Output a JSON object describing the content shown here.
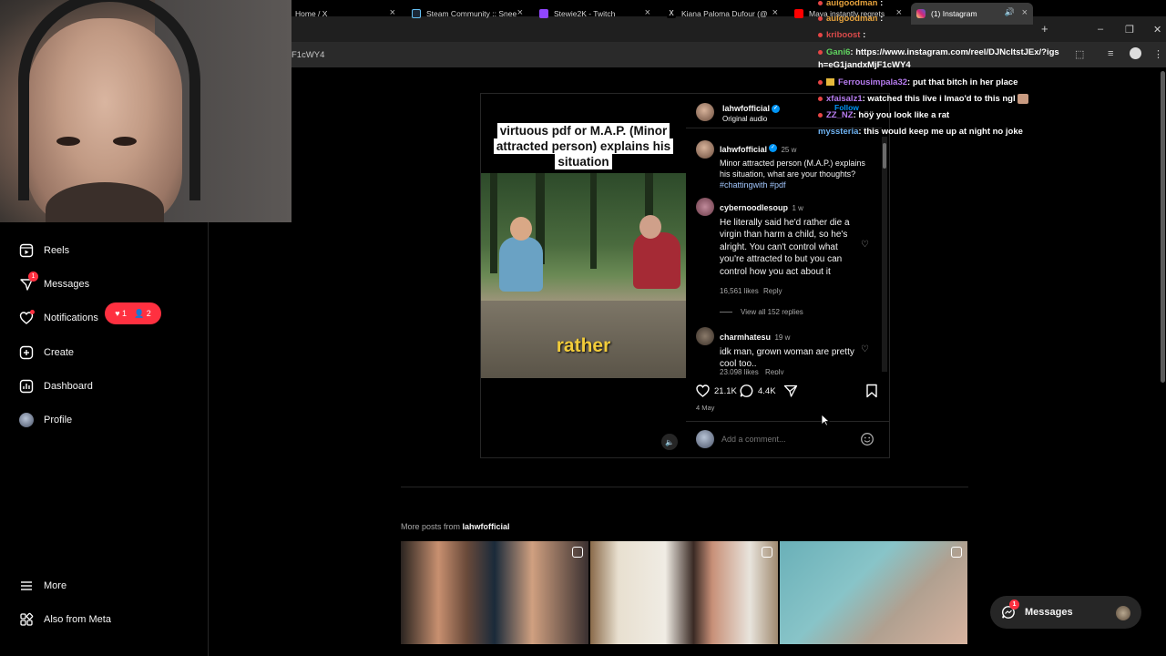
{
  "browser": {
    "tabs": [
      {
        "label": "Home / X",
        "active": false
      },
      {
        "label": "Steam Community :: Snee",
        "active": false
      },
      {
        "label": "Stewie2K - Twitch",
        "active": false
      },
      {
        "label": "Kiana Paloma Dufour (@",
        "active": false
      },
      {
        "label": "Maya instantly regrets",
        "active": false
      },
      {
        "label": "(1) Instagram",
        "active": true
      }
    ],
    "new_tab": "+",
    "url_fragment": "F1cWY4"
  },
  "sidebar": {
    "items": [
      {
        "label": "Reels",
        "icon": "reels-icon"
      },
      {
        "label": "Messages",
        "icon": "messenger-icon",
        "badge": "1"
      },
      {
        "label": "Notifications",
        "icon": "heart-icon"
      },
      {
        "label": "Create",
        "icon": "plus-square-icon"
      },
      {
        "label": "Dashboard",
        "icon": "dashboard-icon"
      },
      {
        "label": "Profile",
        "icon": "avatar"
      }
    ],
    "notif_pill": {
      "likes": "1",
      "follows": "2"
    },
    "bottom": [
      {
        "label": "More",
        "icon": "menu-icon"
      },
      {
        "label": "Also from Meta",
        "icon": "meta-icon"
      }
    ]
  },
  "post": {
    "video_caption": "virtuous pdf or M.A.P. (Minor attracted person) explains his situation",
    "video_word": "rather",
    "author": "lahwfofficial",
    "audio": "Original audio",
    "follow_label": "Follow",
    "caption": {
      "user": "lahwfofficial",
      "time": "25 w",
      "text": "Minor attracted person (M.A.P.) explains his situation, what are your thoughts?",
      "tags": "#chattingwith #pdf"
    },
    "comments": [
      {
        "user": "cybernoodlesoup",
        "time": "1 w",
        "text": "He literally said he'd rather die a virgin than harm a child, so he's alright. You can't control what you're attracted to but you can control how you act about it",
        "likes": "16,561 likes",
        "reply": "Reply",
        "view_replies": "View all 152 replies"
      },
      {
        "user": "charmhatesu",
        "time": "19 w",
        "text": "idk man, grown woman are pretty cool too..",
        "likes": "23,098 likes",
        "reply": "Reply"
      }
    ],
    "like_count": "21.1K",
    "comment_count": "4.4K",
    "date": "4 May",
    "comment_placeholder": "Add a comment..."
  },
  "chat": [
    {
      "name": "auigoodman",
      "msg": ":",
      "color": "#e6a23c"
    },
    {
      "name": "auigoodman",
      "msg": ":",
      "color": "#e6a23c"
    },
    {
      "name": "kriboost",
      "msg": ":",
      "color": "#d94a4a"
    },
    {
      "name": "Gani6",
      "msg": ": https://www.instagram.com/reel/DJNcltstJEx/?igsh=eG1jandxMjF1cWY4",
      "color": "#5fd35f"
    },
    {
      "name": "Ferrousimpala32",
      "msg": ": put that bitch in her place",
      "color": "#b77cf0"
    },
    {
      "name": "xfaisalz1",
      "msg": ": watched this live i lmao'd to this ngl",
      "color": "#b77cf0"
    },
    {
      "name": "ZZ_NZ",
      "msg": ": höÿ you look like a rat",
      "color": "#b77cf0"
    },
    {
      "name": "myssteria",
      "msg": ": this would keep me up at night no joke",
      "color": "#6fb3f2"
    }
  ],
  "more_posts": {
    "prefix": "More posts from",
    "user": "lahwfofficial"
  },
  "messages_button": {
    "label": "Messages",
    "badge": "1"
  }
}
